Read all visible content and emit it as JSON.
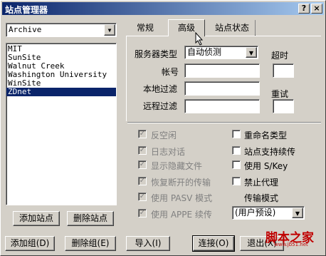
{
  "window": {
    "title": "站点管理器",
    "help_glyph": "?",
    "close_glyph": "×"
  },
  "site_combo": {
    "value": "Archive",
    "arrow": "▼"
  },
  "site_list": {
    "items": [
      "MIT",
      "SunSite",
      "Walnut Creek",
      "Washington University",
      "WinSite",
      "ZDnet"
    ],
    "selected_index": 5
  },
  "left_buttons": {
    "add_site": "添加站点",
    "delete_site": "删除站点"
  },
  "tabs": [
    "常规",
    "高级",
    "站点状态"
  ],
  "active_tab": "高级",
  "advanced": {
    "server_type_label": "服务器类型",
    "server_type_value": "自动侦测",
    "timeout_label": "超时",
    "account_label": "帐号",
    "local_filter_label": "本地过滤",
    "remote_filter_label": "远程过滤",
    "retry_label": "重试"
  },
  "options": {
    "left": [
      {
        "label": "反空闲",
        "checked": true
      },
      {
        "label": "日志对话",
        "checked": true
      },
      {
        "label": "显示隐藏文件",
        "checked": true
      },
      {
        "label": "恢复断开的传输",
        "checked": true
      },
      {
        "label": "使用 PASV 模式",
        "checked": true
      },
      {
        "label": "使用 APPE 续传",
        "checked": true
      }
    ],
    "right": [
      {
        "label": "重命名类型",
        "checked": false
      },
      {
        "label": "站点支持续传",
        "checked": false
      },
      {
        "label": "使用 S/Key",
        "checked": false
      },
      {
        "label": "禁止代理",
        "checked": false
      }
    ],
    "transfer_mode_label": "传输模式",
    "transfer_mode_value": "(用户预设)",
    "check_glyph": "✓"
  },
  "bottom_buttons": {
    "add_group": "添加组(D)",
    "delete_group": "删除组(E)",
    "import": "导入(I)",
    "connect": "连接(O)",
    "exit": "退出(X)"
  },
  "watermark": {
    "text": "脚本之家",
    "url_text": "www.jb51.net"
  }
}
